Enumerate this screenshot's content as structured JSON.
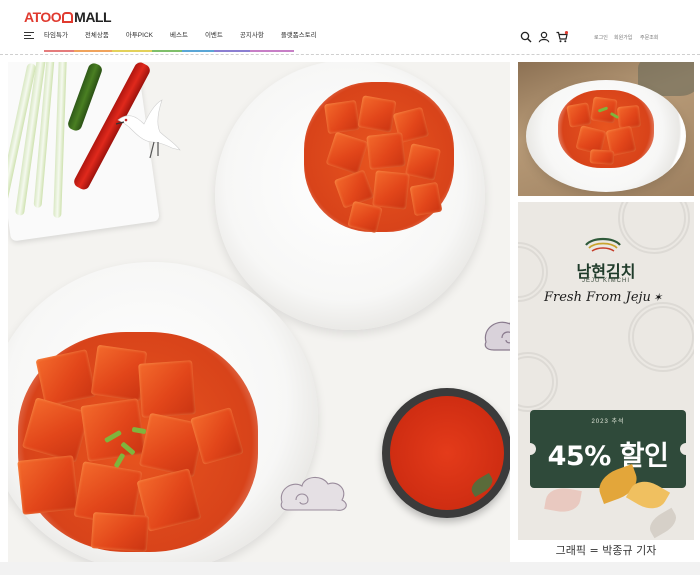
{
  "header": {
    "logo_prefix": "ATOO",
    "logo_suffix": "MALL",
    "nav": [
      "타임특가",
      "전체상품",
      "아투PICK",
      "베스트",
      "이벤트",
      "공지사항",
      "플랫폼스토리"
    ],
    "nav_bar_colors": [
      "#e57c7c",
      "#f0a35c",
      "#e3d15a",
      "#7fbf6a",
      "#5aa6d6",
      "#8b7fd1",
      "#c77fc6"
    ],
    "util_links": [
      "로그인",
      "회원가입",
      "주문조회"
    ],
    "cart_count": "0"
  },
  "hero": {
    "accent": "#e2461a"
  },
  "side_banner": {
    "brand_name": "남현김치",
    "brand_sub": "JEJU KIMCHI",
    "slogan": "Fresh From Jeju",
    "ticket_top": "2023 추석",
    "ticket_main": "45% 할인",
    "caption": "그래픽 = 박종규 기자",
    "ticket_color": "#2f4a3a"
  },
  "icons": [
    "menu-icon",
    "search-icon",
    "user-icon",
    "cart-icon",
    "crane-icon",
    "cloud-icon",
    "brand-logo-icon",
    "star-icon"
  ]
}
